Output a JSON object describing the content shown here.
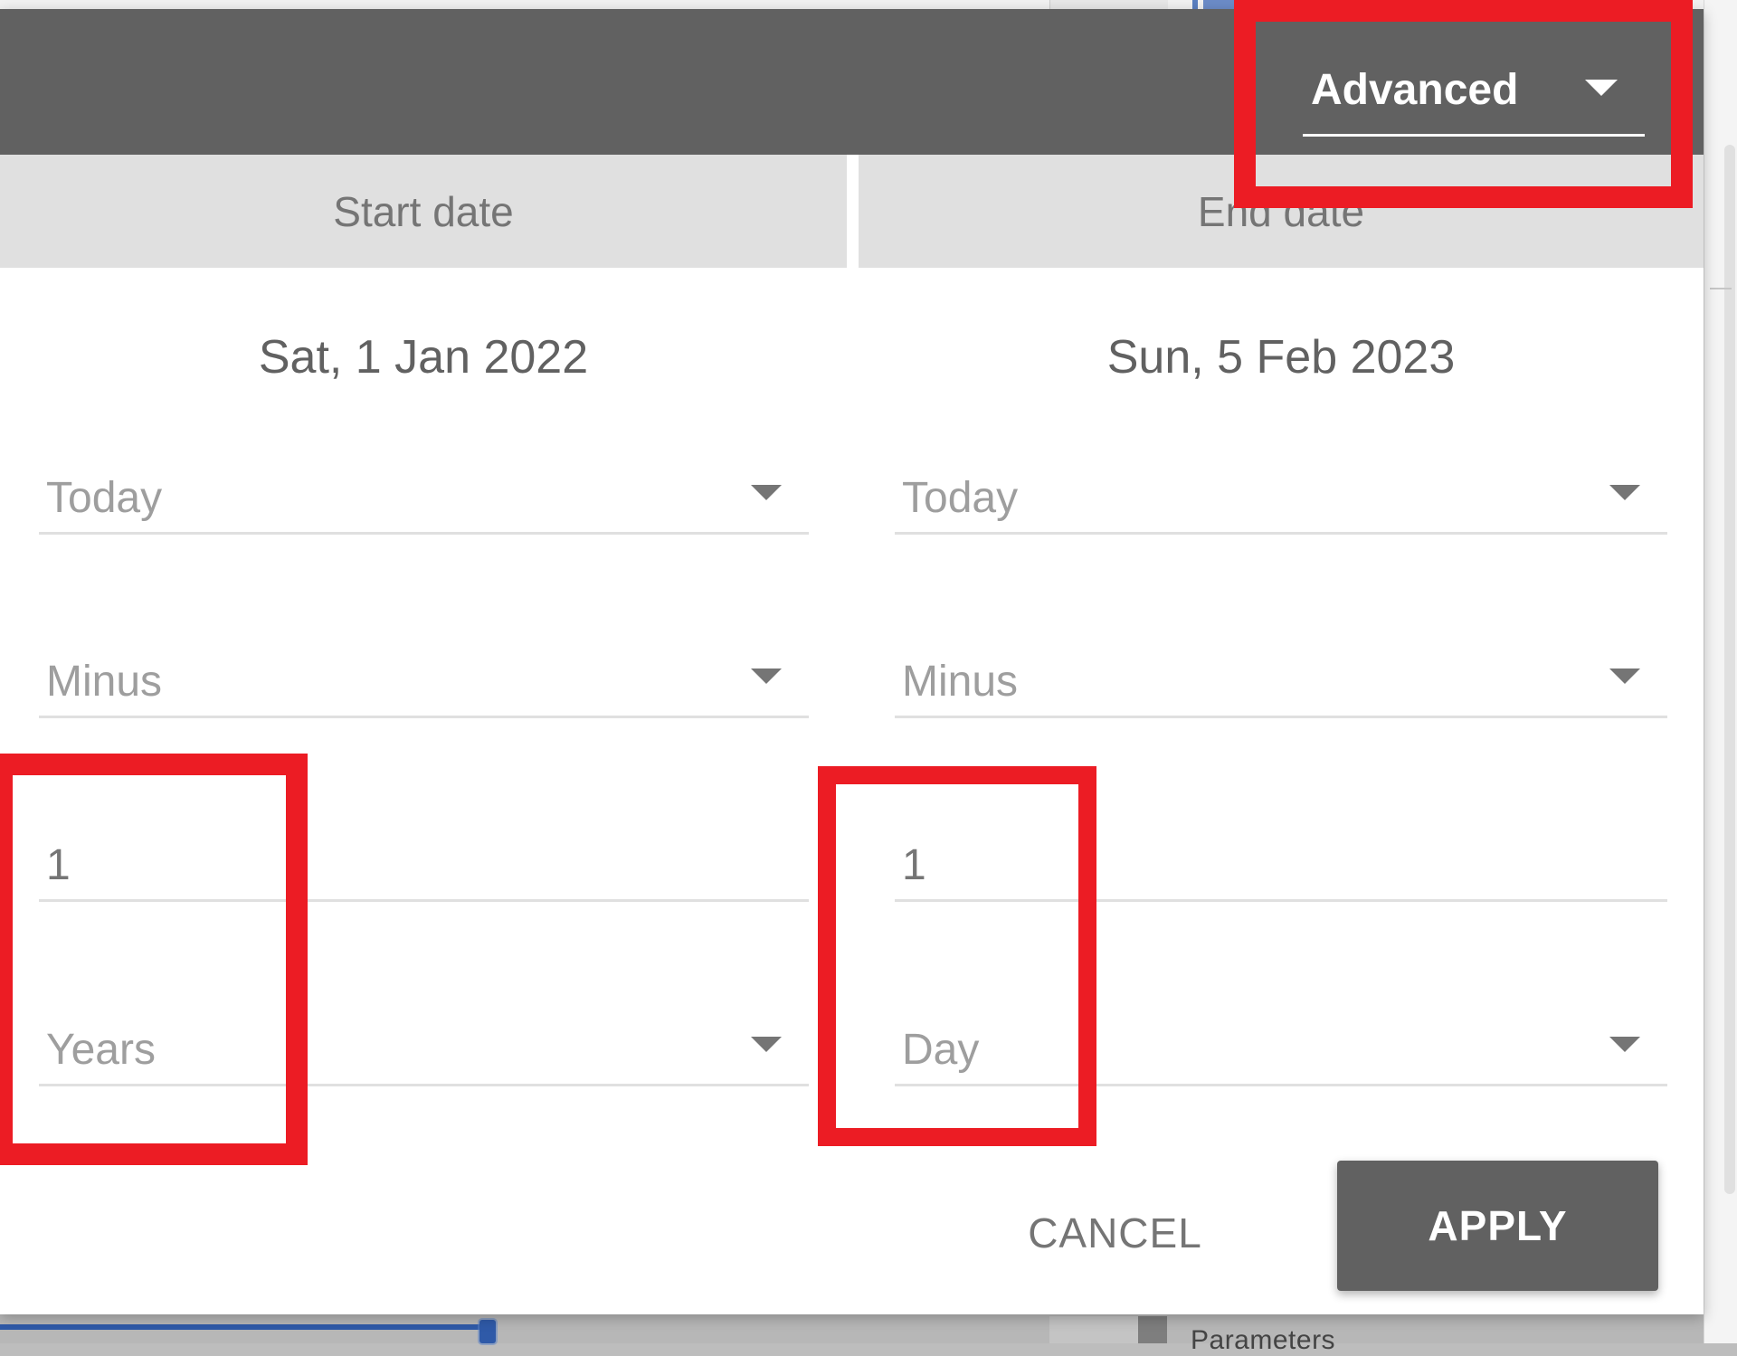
{
  "dialog": {
    "mode_select": {
      "value": "Advanced"
    },
    "columns": {
      "start": {
        "header": "Start date",
        "date": "Sat, 1 Jan 2022",
        "anchor": "Today",
        "operator": "Minus",
        "amount": "1",
        "unit": "Years"
      },
      "end": {
        "header": "End date",
        "date": "Sun, 5 Feb 2023",
        "anchor": "Today",
        "operator": "Minus",
        "amount": "1",
        "unit": "Day"
      }
    },
    "buttons": {
      "cancel": "CANCEL",
      "apply": "APPLY"
    }
  },
  "background": {
    "bottom_panel_label": "Parameters"
  },
  "annotations": {
    "highlight_color": "#ec1c24"
  },
  "colors": {
    "header": "#616161",
    "column_header": "#e0e0e0",
    "slider": "#2f5aa8"
  }
}
